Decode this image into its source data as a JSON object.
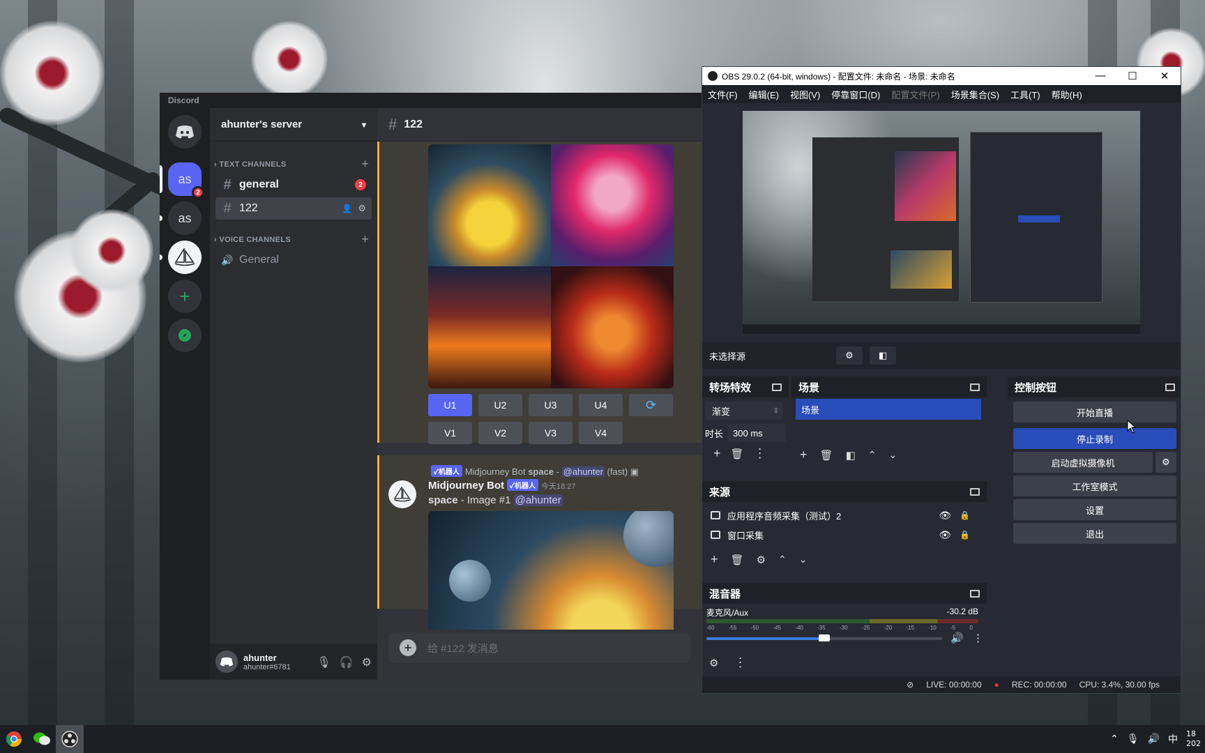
{
  "discord": {
    "brand": "Discord",
    "guilds": [
      {
        "label": "as",
        "badge": "2"
      },
      {
        "label": "as"
      }
    ],
    "server_name": "ahunter's server",
    "text_category": "TEXT CHANNELS",
    "voice_category": "VOICE CHANNELS",
    "channels": [
      {
        "name": "general",
        "badge": "2"
      },
      {
        "name": "122"
      }
    ],
    "voice_channels": [
      {
        "name": "General"
      }
    ],
    "user": {
      "name": "ahunter",
      "tag": "ahunter#6781"
    },
    "current_channel": "122",
    "upscale_buttons": [
      "U1",
      "U2",
      "U3",
      "U4"
    ],
    "variation_buttons": [
      "V1",
      "V2",
      "V3",
      "V4"
    ],
    "reply": {
      "bot_tag": "✓机器人",
      "text": "Midjourney Bot",
      "bold": "space",
      "dash": " - ",
      "mention": "@ahunter",
      "suffix": "(fast)"
    },
    "message": {
      "author": "Midjourney Bot",
      "bot_tag": "✓机器人",
      "timestamp": "今天18:27",
      "bold": "space",
      "text": " - Image #1 ",
      "mention": "@ahunter"
    },
    "composer_placeholder": "给 #122 发消息"
  },
  "obs": {
    "title": "OBS 29.0.2 (64-bit, windows) - 配置文件: 未命名 - 场景: 未命名",
    "menu": [
      "文件(F)",
      "编辑(E)",
      "视图(V)",
      "停靠窗口(D)",
      "配置文件(P)",
      "场景集合(S)",
      "工具(T)",
      "帮助(H)"
    ],
    "no_source": "未选择源",
    "transitions": {
      "title": "转场特效",
      "type": "渐变",
      "duration_label": "时长",
      "duration": "300 ms"
    },
    "scenes": {
      "title": "场景",
      "items": [
        "场景"
      ]
    },
    "sources": {
      "title": "来源",
      "items": [
        "应用程序音频采集（测试）2",
        "窗口采集"
      ]
    },
    "mixer": {
      "title": "混音器",
      "channel": "麦克风/Aux",
      "db": "-30.2 dB",
      "ticks": [
        "-60",
        "-55",
        "-50",
        "-45",
        "-40",
        "-35",
        "-30",
        "-25",
        "-20",
        "-15",
        "-10",
        "-5",
        "0"
      ],
      "volume": 0.5
    },
    "controls": {
      "title": "控制按钮",
      "start_stream": "开始直播",
      "stop_record": "停止录制",
      "virtual_cam": "启动虚拟摄像机",
      "studio": "工作室模式",
      "settings": "设置",
      "exit": "退出"
    },
    "status": {
      "live": "LIVE: 00:00:00",
      "rec": "REC: 00:00:00",
      "cpu": "CPU: 3.4%, 30.00 fps"
    }
  },
  "taskbar": {
    "ime": "中",
    "clock": "18\n202"
  },
  "colors": {
    "blurple": "#5865f2",
    "obs_blue": "#284cb8",
    "danger": "#f23f43"
  }
}
